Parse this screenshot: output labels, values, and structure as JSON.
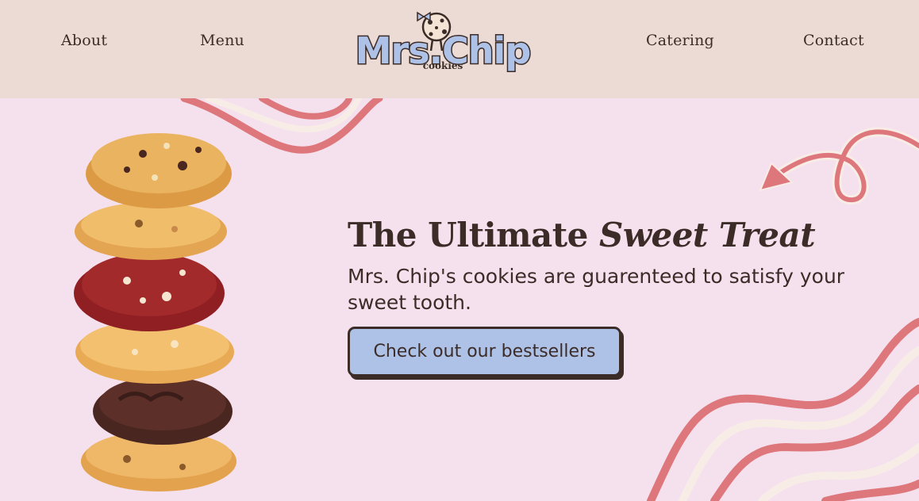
{
  "nav": {
    "about": "About",
    "menu": "Menu",
    "catering": "Catering",
    "contact": "Contact"
  },
  "logo": {
    "title": "Mrs.Chip",
    "subtitle": "cookies"
  },
  "hero": {
    "headline_plain": "The Ultimate ",
    "headline_italic": "Sweet Treat",
    "subtext": "Mrs. Chip's cookies are guarenteed to satisfy your sweet tooth.",
    "cta_label": "Check out our bestsellers"
  },
  "colors": {
    "header_bg": "#ebdbd4",
    "hero_bg": "#f5e1ee",
    "text": "#3b2c28",
    "button_bg": "#aec1e7",
    "wave_pink": "#de777c",
    "wave_cream": "#f8ece6"
  },
  "icons": [
    "cookie-mascot-icon",
    "arrow-doodle-icon",
    "wave-decoration"
  ]
}
